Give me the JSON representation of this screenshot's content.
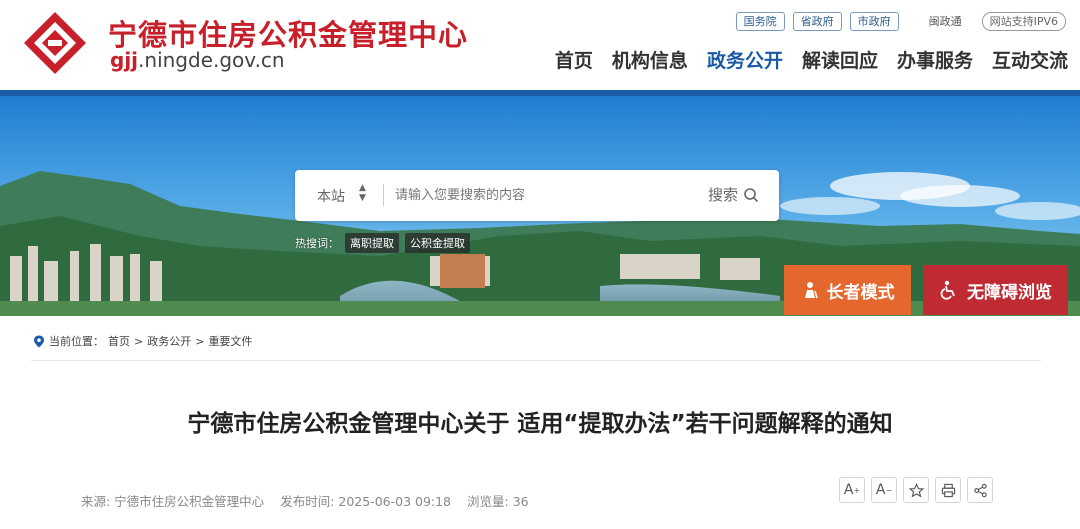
{
  "header": {
    "site_name": "宁德市住房公积金管理中心",
    "domain_prefix": "gjj",
    "domain_suffix": ".ningde.gov.cn",
    "top_links": {
      "gov_links": [
        "国务院",
        "省政府",
        "市政府"
      ],
      "min_zheng_tong": "闽政通",
      "ipv6": "网站支持IPV6"
    },
    "nav": [
      {
        "label": "首页",
        "active": false
      },
      {
        "label": "机构信息",
        "active": false
      },
      {
        "label": "政务公开",
        "active": true
      },
      {
        "label": "解读回应",
        "active": false
      },
      {
        "label": "办事服务",
        "active": false
      },
      {
        "label": "互动交流",
        "active": false
      }
    ]
  },
  "search": {
    "scope": "本站",
    "placeholder": "请输入您要搜索的内容",
    "button_label": "搜索",
    "hot_label": "热搜词：",
    "hot_words": [
      "离职提取",
      "公积金提取"
    ]
  },
  "modes": {
    "elder": "长者模式",
    "accessible": "无障碍浏览"
  },
  "breadcrumb": {
    "label": "当前位置：",
    "items": [
      "首页",
      "政务公开",
      "重要文件"
    ],
    "separator": ">"
  },
  "article": {
    "title": "宁德市住房公积金管理中心关于 适用“提取办法”若干问题解释的通知",
    "source": "来源: 宁德市住房公积金管理中心",
    "published": "发布时间: 2025-06-03 09:18",
    "views": "浏览量: 36"
  },
  "colors": {
    "brand_red": "#c8202b",
    "nav_blue": "#1b5aa6",
    "elder_orange": "#e5672d",
    "access_red": "#c02a32"
  }
}
